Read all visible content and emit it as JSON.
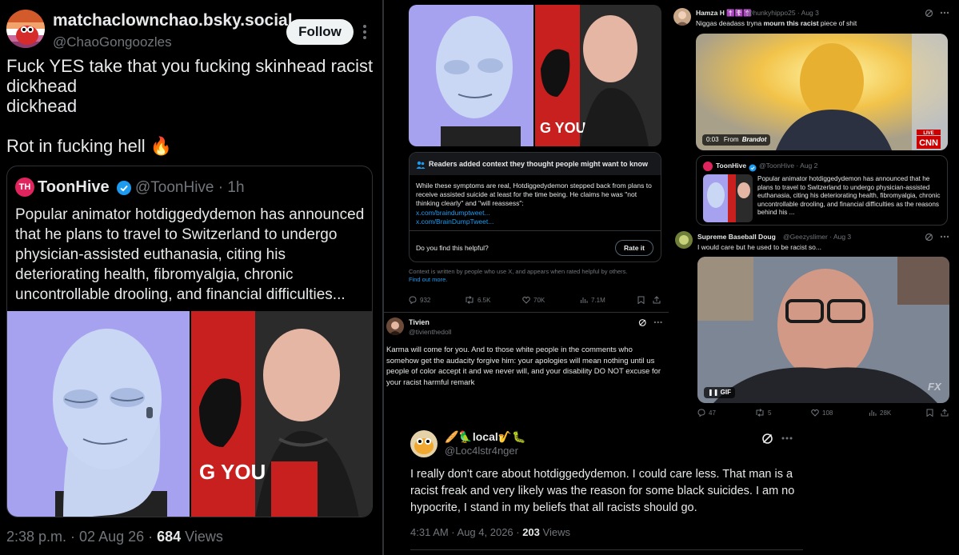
{
  "main_tweet": {
    "display_name": "matchaclownchao.bsky.social",
    "handle": "@ChaoGongoozles",
    "follow_label": "Follow",
    "avatar_icon": "red-cartoon-avatar-icon",
    "body": "Fuck YES take that you fucking skinhead racist\ndickhead\ndickhead\n\nRot in fucking hell 🔥",
    "quote": {
      "avatar_text": "TH",
      "name": "ToonHive",
      "handle": "@ToonHive · 1h",
      "text": "Popular animator hotdiggedydemon has announced that he plans to travel to Switzerland to undergo physician-assisted euthanasia, citing his deteriorating health, fibromyalgia, chronic uncontrollable drooling, and financial difficulties..."
    },
    "time": "2:38 p.m. · 02 Aug 26 · ",
    "views_count": "684",
    "views_label": " Views"
  },
  "middle": {
    "note": {
      "title": "Readers added context they thought people might want to know",
      "text": "While these symptoms are real, Hotdiggedydemon stepped back from plans to receive assisted suicide at least for the time being. He claims he was \"not thinking clearly\" and \"will reassess\":",
      "link1": "x.com/braindumptweet...",
      "link2": "x.com/BrainDumpTweet...",
      "helpful_q": "Do you find this helpful?",
      "rate_label": "Rate it"
    },
    "disclaimer": "Context is written by people who use X, and appears when rated helpful by others.",
    "find_more": "Find out more.",
    "actions": {
      "replies": "932",
      "reposts": "6.5K",
      "likes": "70K",
      "views": "7.1M"
    },
    "reply": {
      "name": "Tivien",
      "handle": "@tivienthedoll",
      "text": "Karma will come for you. And to those white people in the comments who somehow get the audacity forgive him: your apologies will mean nothing until us people of color accept it and we never will, and your disability DO NOT excuse for your racist harmful remark"
    }
  },
  "right": {
    "reply1": {
      "name": "Hamza H ✝️☦️✝️",
      "handle": "@hunkyhippo25 · Aug 3",
      "text_pre": "Niggas deadass tryna ",
      "text_bold": "mourn this racist",
      "text_post": " piece of shit",
      "video_time": "0:03",
      "video_from": "From",
      "video_src": "Brandot",
      "live_label": "LIVE",
      "quote": {
        "name": "ToonHive",
        "handle": "@ToonHive · Aug 2",
        "text": "Popular animator hotdiggedydemon has announced that he plans to travel to Switzerland to undergo physician-assisted euthanasia, citing his deteriorating health, fibromyalgia, chronic uncontrollable drooling, and financial difficulties as the reasons behind his ..."
      }
    },
    "reply2": {
      "name": "Supreme Baseball Doug",
      "handle": "@Geezyslimer · Aug 3",
      "text": "I would care but he used to be racist so...",
      "gif_label": "GIF",
      "watermark": "FX"
    },
    "actions": {
      "replies": "47",
      "reposts": "5",
      "likes": "108",
      "views": "28K"
    }
  },
  "bottom": {
    "name": "🥖🦜local🎷🐛",
    "handle": "@Loc4lstr4nger",
    "text": "I really don't care about hotdiggedydemon. I could care less. That man is a racist freak and very likely was the reason for some black suicides. I am no hypocrite, I stand in my beliefs that all racists should go.",
    "time": "4:31 AM · Aug 4, 2026 · ",
    "views_count": "203",
    "views_label": " Views"
  },
  "colors": {
    "accent": "#1d9bf0",
    "muted": "#71767b",
    "border": "#2f3336",
    "verified": "#1d9bf0"
  }
}
